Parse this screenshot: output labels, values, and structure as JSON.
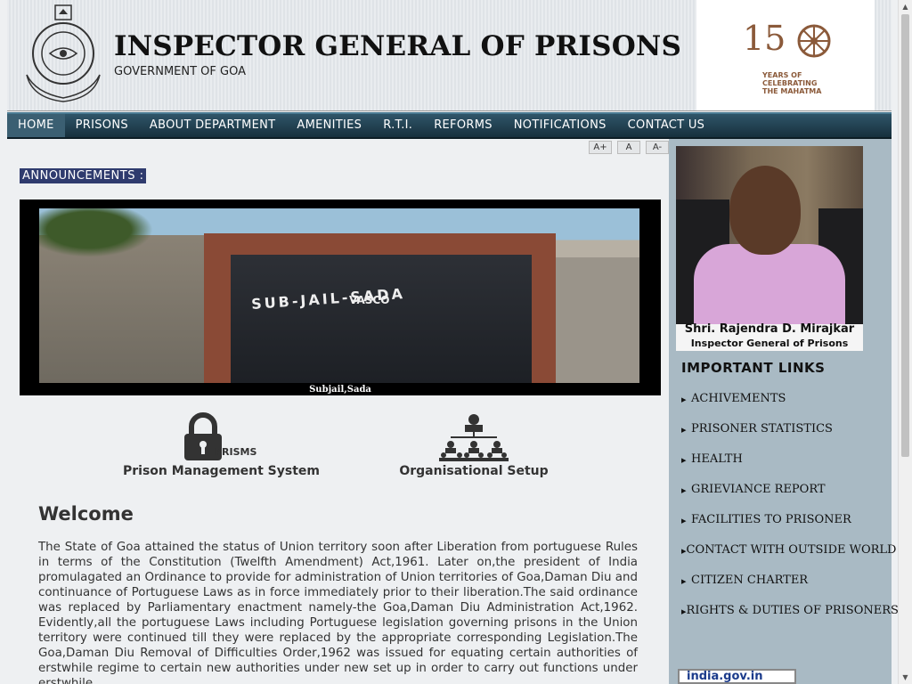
{
  "header": {
    "title": "INSPECTOR GENERAL OF PRISONS",
    "subtitle": "GOVERNMENT OF GOA",
    "logo_150": {
      "number": "15",
      "caption": "YEARS OF CELEBRATING THE MAHATMA"
    },
    "emblem_text": "GOVERNMENT OF GOA"
  },
  "nav": {
    "items": [
      "HOME",
      "PRISONS",
      "ABOUT DEPARTMENT",
      "AMENITIES",
      "R.T.I.",
      "REFORMS",
      "NOTIFICATIONS",
      "CONTACT US"
    ],
    "active": "HOME"
  },
  "font_controls": [
    "A+",
    "A",
    "A-"
  ],
  "announcements": {
    "label": "ANNOUNCEMENTS :"
  },
  "banner": {
    "gate_text": "SUB-JAIL-SADA",
    "gate_subtext": "VASCO",
    "caption": "Subjail,Sada"
  },
  "quick_links": [
    {
      "label": "Prison Management System",
      "icon_text": "PRISMS"
    },
    {
      "label": "Organisational Setup"
    }
  ],
  "welcome": {
    "heading": "Welcome",
    "text": "The State of Goa attained the status of Union territory soon after Liberation from portuguese Rules in terms of the Constitution (Twelfth Amendment) Act,1961. Later on,the president of India promulagated an Ordinance to provide for administration of Union territories of Goa,Daman Diu and continuance of Portuguese Laws as in force immediately prior to their liberation.The said ordinance was replaced by Parliamentary enactment namely-the Goa,Daman Diu Administration Act,1962. Evidently,all the portuguese Laws including Portuguese legislation governing prisons in the Union territory were continued till they were replaced by the appropriate corresponding Legislation.The Goa,Daman Diu Removal of Difficulties Order,1962 was issued for equating certain authorities of erstwhile regime to certain new authorities under new set up in order to carry out functions under erstwhile"
  },
  "official": {
    "name": "Shri. Rajendra D. Mirajkar",
    "title": "Inspector General of Prisons"
  },
  "important_links": {
    "heading": "IMPORTANT LINKS",
    "items": [
      "ACHIVEMENTS",
      "PRISONER STATISTICS",
      "HEALTH",
      "GRIEVIANCE REPORT",
      "FACILITIES TO PRISONER",
      "CONTACT WITH OUTSIDE WORLD",
      "CITIZEN CHARTER",
      "RIGHTS & DUTIES OF PRISONERS"
    ]
  },
  "footer_badge": "india.gov.in"
}
